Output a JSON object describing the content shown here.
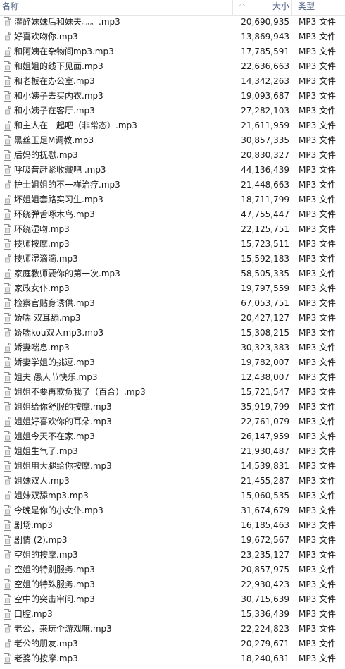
{
  "columns": {
    "name": "名称",
    "size": "大小",
    "type": "类型"
  },
  "files": [
    {
      "name": "灌醉妹妹后和妹夫。。。.mp3",
      "size": "20,690,935",
      "type": "MP3 文件"
    },
    {
      "name": "好喜欢吻你.mp3",
      "size": "13,869,943",
      "type": "MP3 文件"
    },
    {
      "name": "和阿姨在杂物间mp3.mp3",
      "size": "17,785,591",
      "type": "MP3 文件"
    },
    {
      "name": "和姐姐的线下见面.mp3",
      "size": "22,636,663",
      "type": "MP3 文件"
    },
    {
      "name": "和老板在办公室.mp3",
      "size": "14,342,263",
      "type": "MP3 文件"
    },
    {
      "name": "和小姨子去买内衣.mp3",
      "size": "19,093,687",
      "type": "MP3 文件"
    },
    {
      "name": "和小姨子在客厅.mp3",
      "size": "27,282,103",
      "type": "MP3 文件"
    },
    {
      "name": "和主人在一起吧（非常态）.mp3",
      "size": "21,611,959",
      "type": "MP3 文件"
    },
    {
      "name": "黑丝玉足M调教.mp3",
      "size": "30,857,335",
      "type": "MP3 文件"
    },
    {
      "name": "后妈的抚慰.mp3",
      "size": "20,830,327",
      "type": "MP3 文件"
    },
    {
      "name": "呼吸音赶紧收藏吧 .mp3",
      "size": "44,136,439",
      "type": "MP3 文件"
    },
    {
      "name": "护士姐姐的不一样治疗.mp3",
      "size": "21,448,663",
      "type": "MP3 文件"
    },
    {
      "name": "坏姐姐套路实习生.mp3",
      "size": "18,711,799",
      "type": "MP3 文件"
    },
    {
      "name": "环绕弹舌啄木鸟.mp3",
      "size": "47,755,447",
      "type": "MP3 文件"
    },
    {
      "name": "环绕湿吻.mp3",
      "size": "22,125,751",
      "type": "MP3 文件"
    },
    {
      "name": "技师按摩.mp3",
      "size": "15,723,511",
      "type": "MP3 文件"
    },
    {
      "name": "技师湿滴滴.mp3",
      "size": "15,592,183",
      "type": "MP3 文件"
    },
    {
      "name": "家庭教师要你的第一次.mp3",
      "size": "58,505,335",
      "type": "MP3 文件"
    },
    {
      "name": "家政女仆.mp3",
      "size": "19,797,559",
      "type": "MP3 文件"
    },
    {
      "name": "检察官贴身诱供.mp3",
      "size": "67,053,751",
      "type": "MP3 文件"
    },
    {
      "name": "娇喘 双耳舔.mp3",
      "size": "20,427,127",
      "type": "MP3 文件"
    },
    {
      "name": "娇喘kou双人mp3.mp3",
      "size": "15,308,215",
      "type": "MP3 文件"
    },
    {
      "name": "娇妻喘息.mp3",
      "size": "30,323,383",
      "type": "MP3 文件"
    },
    {
      "name": "娇妻学姐的挑逗.mp3",
      "size": "19,782,007",
      "type": "MP3 文件"
    },
    {
      "name": "姐夫 愚人节快乐.mp3",
      "size": "12,438,007",
      "type": "MP3 文件"
    },
    {
      "name": "姐姐不要再欺负我了（百合）.mp3",
      "size": "15,721,547",
      "type": "MP3 文件"
    },
    {
      "name": "姐姐给你舒服的按摩.mp3",
      "size": "35,919,799",
      "type": "MP3 文件"
    },
    {
      "name": "姐姐好喜欢你的耳朵.mp3",
      "size": "22,761,079",
      "type": "MP3 文件"
    },
    {
      "name": "姐姐今天不在家.mp3",
      "size": "26,147,959",
      "type": "MP3 文件"
    },
    {
      "name": "姐姐生气了.mp3",
      "size": "21,930,487",
      "type": "MP3 文件"
    },
    {
      "name": "姐姐用大腿给你按摩.mp3",
      "size": "14,539,831",
      "type": "MP3 文件"
    },
    {
      "name": "姐妹双人.mp3",
      "size": "21,455,287",
      "type": "MP3 文件"
    },
    {
      "name": "姐妹双舔mp3.mp3",
      "size": "15,060,535",
      "type": "MP3 文件"
    },
    {
      "name": "今晚是你的小女仆.mp3",
      "size": "31,674,679",
      "type": "MP3 文件"
    },
    {
      "name": "剧场.mp3",
      "size": "16,185,463",
      "type": "MP3 文件"
    },
    {
      "name": "剧情 (2).mp3",
      "size": "19,672,567",
      "type": "MP3 文件"
    },
    {
      "name": "空姐的按摩.mp3",
      "size": "23,235,127",
      "type": "MP3 文件"
    },
    {
      "name": "空姐的特别服务.mp3",
      "size": "20,857,975",
      "type": "MP3 文件"
    },
    {
      "name": "空姐的特殊服务.mp3",
      "size": "22,930,423",
      "type": "MP3 文件"
    },
    {
      "name": "空中的突击审问.mp3",
      "size": "30,715,639",
      "type": "MP3 文件"
    },
    {
      "name": "口腔.mp3",
      "size": "15,336,439",
      "type": "MP3 文件"
    },
    {
      "name": "老公，来玩个游戏嘛.mp3",
      "size": "22,224,823",
      "type": "MP3 文件"
    },
    {
      "name": "老公的朋友.mp3",
      "size": "20,279,671",
      "type": "MP3 文件"
    },
    {
      "name": "老婆的按摩.mp3",
      "size": "18,240,631",
      "type": "MP3 文件"
    }
  ],
  "icons": {
    "file": "mp3-file-icon",
    "sort": "sort-up-icon"
  }
}
